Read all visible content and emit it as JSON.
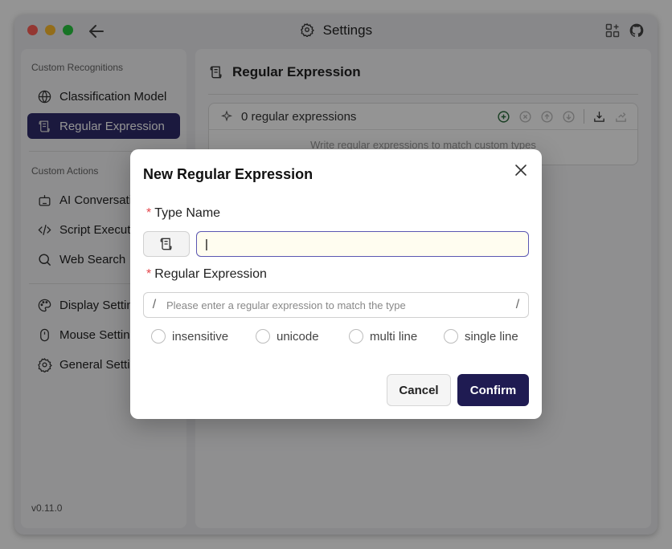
{
  "window": {
    "title": "Settings"
  },
  "sidebar": {
    "sections": [
      {
        "title": "Custom Recognitions",
        "items": [
          {
            "label": "Classification Model",
            "icon": "globe-icon"
          },
          {
            "label": "Regular Expression",
            "icon": "scroll-icon",
            "active": true
          }
        ]
      },
      {
        "title": "Custom Actions",
        "items": [
          {
            "label": "AI Conversation",
            "icon": "robot-icon"
          },
          {
            "label": "Script Execution",
            "icon": "code-icon"
          },
          {
            "label": "Web Search",
            "icon": "search-icon"
          }
        ]
      },
      {
        "title": "",
        "items": [
          {
            "label": "Display Settings",
            "icon": "palette-icon"
          },
          {
            "label": "Mouse Settings",
            "icon": "mouse-icon"
          },
          {
            "label": "General Settings",
            "icon": "gear-icon"
          }
        ]
      }
    ],
    "version": "v0.11.0"
  },
  "main": {
    "title": "Regular Expression",
    "count_label": "0 regular expressions",
    "empty_text": "Write regular expressions to match custom types"
  },
  "modal": {
    "title": "New Regular Expression",
    "type_name_label": "Type Name",
    "regex_label": "Regular Expression",
    "regex_placeholder": "Please enter a regular expression to match the type",
    "slash": "/",
    "flags": [
      "insensitive",
      "unicode",
      "multi line",
      "single line"
    ],
    "cancel": "Cancel",
    "confirm": "Confirm"
  },
  "colors": {
    "accent": "#1f1b52",
    "sidebar_active": "#2f2c6c",
    "required": "#e5484d"
  }
}
